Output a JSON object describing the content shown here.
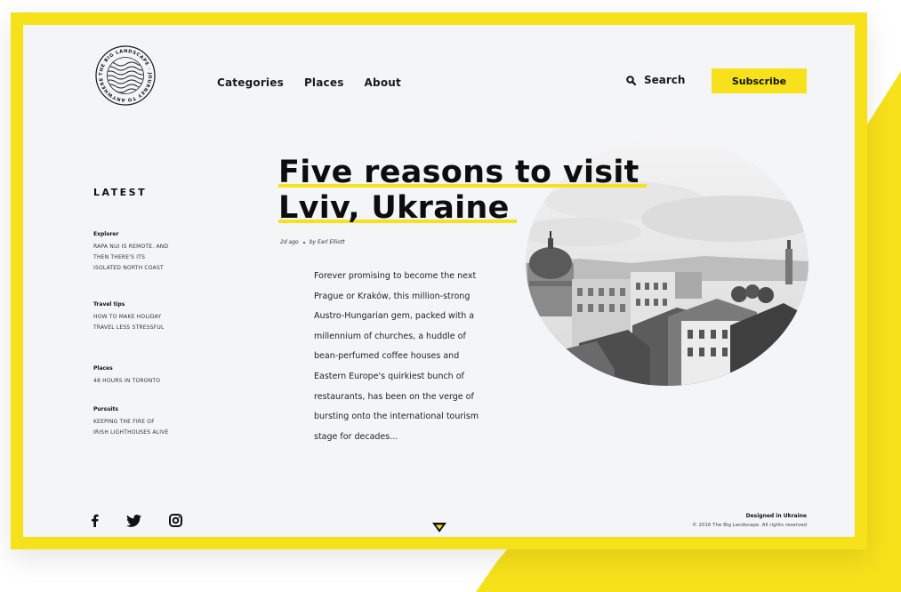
{
  "header": {
    "nav": [
      "Categories",
      "Places",
      "About"
    ],
    "search_label": "Search",
    "subscribe_label": "Subscribe",
    "logo_ring_text": "THE BIG LANDSCAPE · JOURNEY TO ANYWHERE ·"
  },
  "sidebar": {
    "title": "LATEST",
    "items": [
      {
        "category": "Explorer",
        "title_lines": [
          "RAPA NUI IS REMOTE. AND",
          "THEN THERE'S ITS",
          "ISOLATED NORTH COAST"
        ]
      },
      {
        "category": "Travel tips",
        "title_lines": [
          "HOW TO MAKE HOLIDAY",
          "TRAVEL LESS STRESSFUL"
        ]
      },
      {
        "category": "Places",
        "title_lines": [
          "48 HOURS IN TORONTO"
        ]
      },
      {
        "category": "Pursuits",
        "title_lines": [
          "KEEPING THE FIRE OF",
          "IRISH LIGHTHOUSES ALIVE"
        ]
      }
    ]
  },
  "article": {
    "title_line1": "Five reasons to visit",
    "title_line2": "Lviv, Ukraine",
    "time": "2d ago",
    "author": "by Earl Elliott",
    "excerpt_lines": [
      "Forever promising to become the next",
      "Prague or Kraków, this million-strong",
      "Austro-Hungarian gem, packed with a",
      "millennium of churches, a huddle of",
      "bean-perfumed coffee houses and",
      "Eastern Europe's quirkiest bunch of",
      "restaurants, has been on the verge of",
      "bursting onto the international tourism",
      "stage for decades..."
    ]
  },
  "footer": {
    "social_icons": [
      "facebook-icon",
      "twitter-icon",
      "instagram-icon"
    ],
    "made_in": "Designed in Ukraine",
    "copyright": "© 2016 The Big Landscape. All rights reserved"
  },
  "colors": {
    "accent": "#f7e11a",
    "page": "#f3f5f6",
    "text": "#111111"
  }
}
